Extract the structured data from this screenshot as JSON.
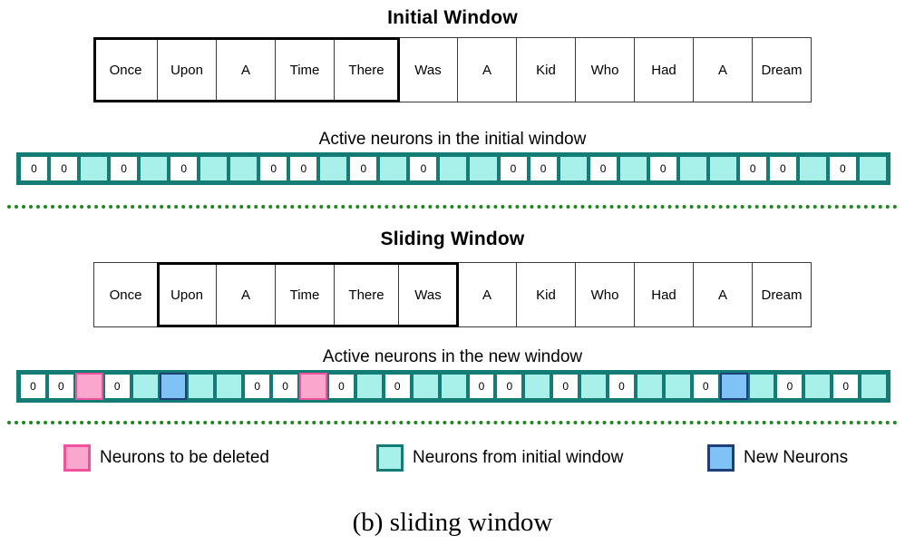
{
  "colors": {
    "cyan_fill": "#a8f0ea",
    "cyan_border": "#137c74",
    "pink_fill": "#fba7cd",
    "pink_border": "#f0539c",
    "blue_fill": "#7fc2f5",
    "blue_border": "#1f3f78",
    "separator_green": "#1a8a1a",
    "text": "#000000"
  },
  "initial_section": {
    "title": "Initial Window",
    "tokens": [
      "Once",
      "Upon",
      "A",
      "Time",
      "There",
      "Was",
      "A",
      "Kid",
      "Who",
      "Had",
      "A",
      "Dream"
    ],
    "window_start_index": 0,
    "window_end_index": 4,
    "neuron_label": "Active neurons in the initial window",
    "neuron_cells": [
      {
        "state": "empty",
        "text": "0"
      },
      {
        "state": "empty",
        "text": "0"
      },
      {
        "state": "cyan",
        "text": ""
      },
      {
        "state": "empty",
        "text": "0"
      },
      {
        "state": "cyan",
        "text": ""
      },
      {
        "state": "empty",
        "text": "0"
      },
      {
        "state": "cyan",
        "text": ""
      },
      {
        "state": "cyan",
        "text": ""
      },
      {
        "state": "empty",
        "text": "0"
      },
      {
        "state": "empty",
        "text": "0"
      },
      {
        "state": "cyan",
        "text": ""
      },
      {
        "state": "empty",
        "text": "0"
      },
      {
        "state": "cyan",
        "text": ""
      },
      {
        "state": "empty",
        "text": "0"
      },
      {
        "state": "cyan",
        "text": ""
      },
      {
        "state": "cyan",
        "text": ""
      },
      {
        "state": "empty",
        "text": "0"
      },
      {
        "state": "empty",
        "text": "0"
      },
      {
        "state": "cyan",
        "text": ""
      },
      {
        "state": "empty",
        "text": "0"
      },
      {
        "state": "cyan",
        "text": ""
      },
      {
        "state": "empty",
        "text": "0"
      },
      {
        "state": "cyan",
        "text": ""
      },
      {
        "state": "cyan",
        "text": ""
      },
      {
        "state": "empty",
        "text": "0"
      },
      {
        "state": "empty",
        "text": "0"
      },
      {
        "state": "cyan",
        "text": ""
      },
      {
        "state": "empty",
        "text": "0"
      },
      {
        "state": "cyan",
        "text": ""
      }
    ]
  },
  "sliding_section": {
    "title": "Sliding Window",
    "tokens": [
      "Once",
      "Upon",
      "A",
      "Time",
      "There",
      "Was",
      "A",
      "Kid",
      "Who",
      "Had",
      "A",
      "Dream"
    ],
    "window_start_index": 1,
    "window_end_index": 5,
    "neuron_label": "Active neurons in the new window",
    "neuron_cells": [
      {
        "state": "empty",
        "text": "0"
      },
      {
        "state": "empty",
        "text": "0"
      },
      {
        "state": "pink",
        "text": ""
      },
      {
        "state": "empty",
        "text": "0"
      },
      {
        "state": "cyan",
        "text": ""
      },
      {
        "state": "blue",
        "text": ""
      },
      {
        "state": "cyan",
        "text": ""
      },
      {
        "state": "cyan",
        "text": ""
      },
      {
        "state": "empty",
        "text": "0"
      },
      {
        "state": "empty",
        "text": "0"
      },
      {
        "state": "pink",
        "text": ""
      },
      {
        "state": "empty",
        "text": "0"
      },
      {
        "state": "cyan",
        "text": ""
      },
      {
        "state": "empty",
        "text": "0"
      },
      {
        "state": "cyan",
        "text": ""
      },
      {
        "state": "cyan",
        "text": ""
      },
      {
        "state": "empty",
        "text": "0"
      },
      {
        "state": "empty",
        "text": "0"
      },
      {
        "state": "cyan",
        "text": ""
      },
      {
        "state": "empty",
        "text": "0"
      },
      {
        "state": "cyan",
        "text": ""
      },
      {
        "state": "empty",
        "text": "0"
      },
      {
        "state": "cyan",
        "text": ""
      },
      {
        "state": "cyan",
        "text": ""
      },
      {
        "state": "empty",
        "text": "0"
      },
      {
        "state": "blue",
        "text": ""
      },
      {
        "state": "cyan",
        "text": ""
      },
      {
        "state": "empty",
        "text": "0"
      },
      {
        "state": "cyan",
        "text": ""
      },
      {
        "state": "empty",
        "text": "0"
      },
      {
        "state": "cyan",
        "text": ""
      }
    ]
  },
  "legend": {
    "items": [
      {
        "swatch": "pink",
        "label": "Neurons to be deleted"
      },
      {
        "swatch": "cyan",
        "label": "Neurons from initial window"
      },
      {
        "swatch": "blue",
        "label": "New Neurons"
      }
    ]
  },
  "caption": "(b) sliding window"
}
